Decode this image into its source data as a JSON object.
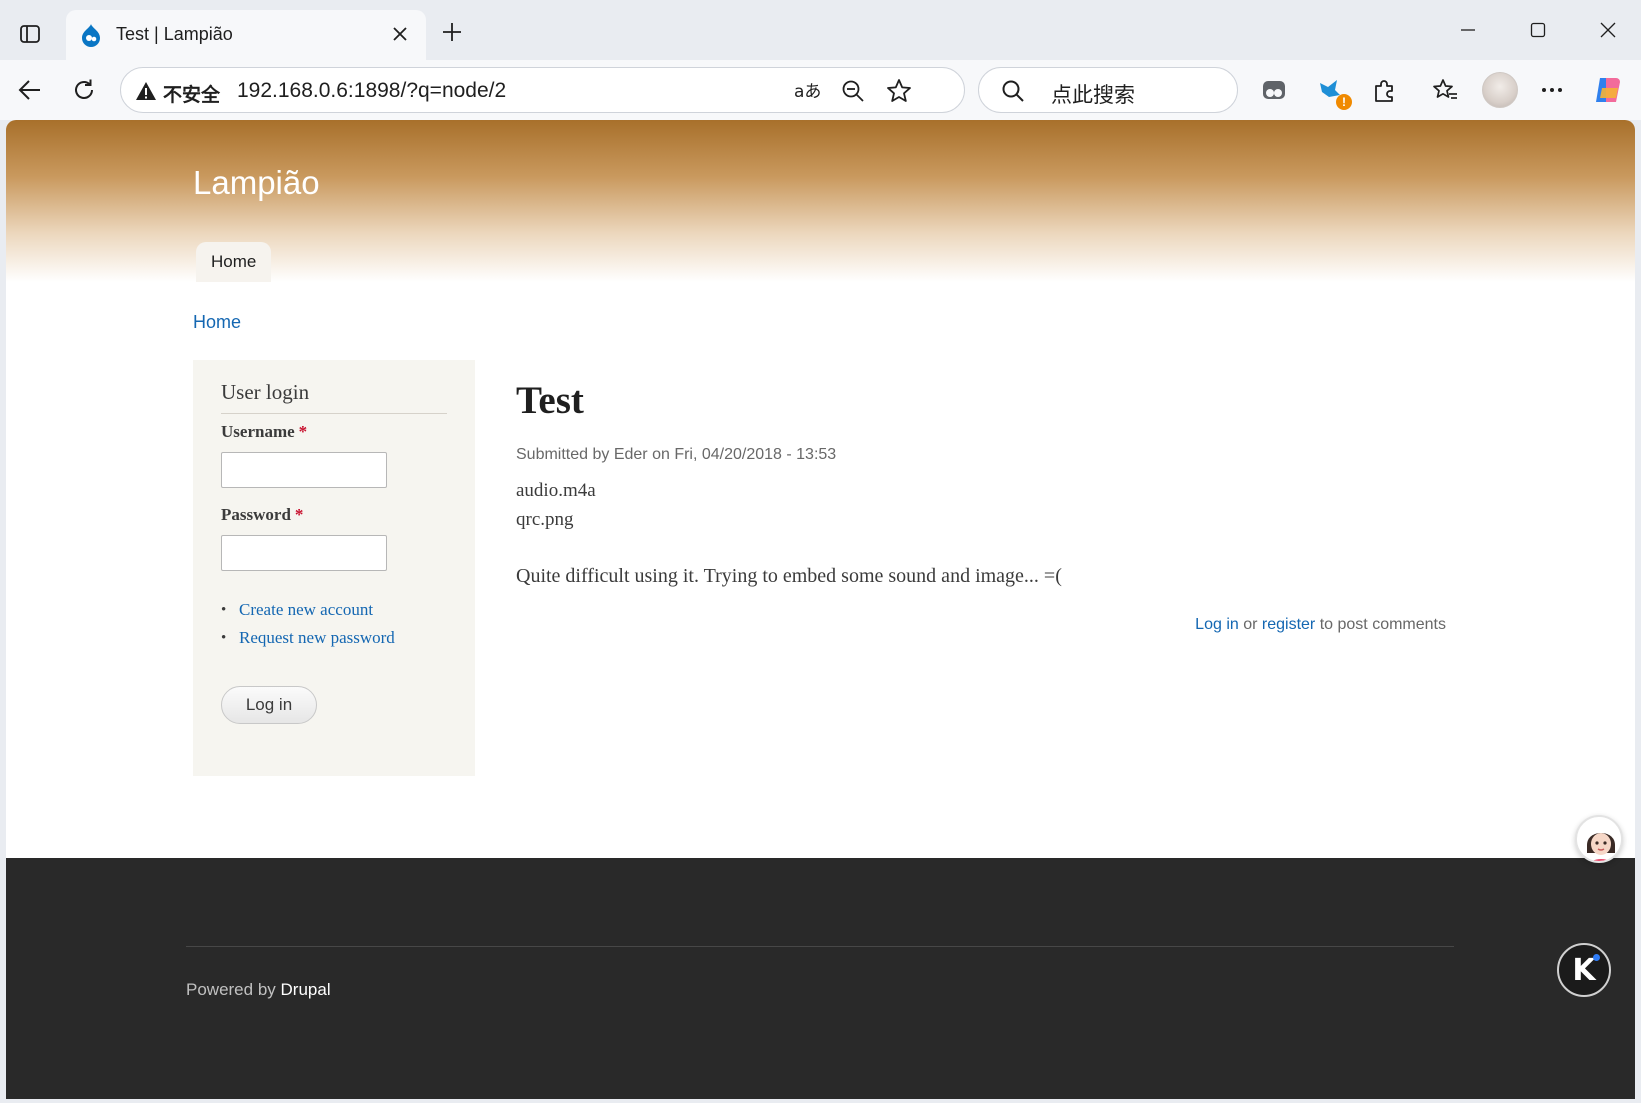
{
  "browser": {
    "tab_title": "Test | Lampião",
    "address": {
      "security_label": "不安全",
      "url": "192.168.0.6:1898/?q=node/2"
    },
    "search": {
      "placeholder": "点此搜索"
    },
    "extension_badge": "!"
  },
  "page": {
    "site_name": "Lampião",
    "nav": {
      "home": "Home"
    },
    "breadcrumb": "Home",
    "login_block": {
      "title": "User login",
      "username_label": "Username",
      "password_label": "Password",
      "required_marker": "*",
      "username_value": "",
      "password_value": "",
      "links": [
        "Create new account",
        "Request new password"
      ],
      "login_button": "Log in"
    },
    "node": {
      "title": "Test",
      "submitted": "Submitted by Eder on Fri, 04/20/2018 - 13:53",
      "files": [
        "audio.m4a",
        "qrc.png"
      ],
      "body": "Quite difficult using it. Trying to embed some sound and image... =(",
      "comments": {
        "login_link": "Log in",
        "or": "or",
        "register_link": "register",
        "suffix": "to post comments"
      }
    },
    "footer": {
      "powered_by": "Powered by",
      "drupal": "Drupal"
    }
  },
  "floating": {
    "k_button": "K"
  },
  "colors": {
    "header_top": "#a8702b",
    "link": "#1467b2",
    "footer_bg": "#292929",
    "sidebar_bg": "#f6f5f0"
  }
}
